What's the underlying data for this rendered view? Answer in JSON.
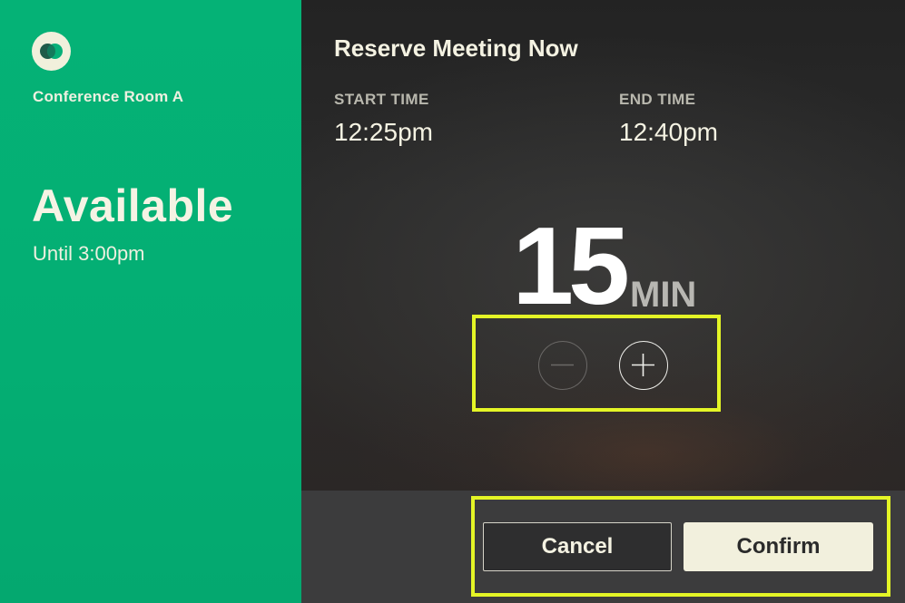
{
  "room": {
    "name": "Conference Room A",
    "status": "Available",
    "status_detail": "Until 3:00pm",
    "logo_icon": "overlapping-circles-logo"
  },
  "booking": {
    "title": "Reserve Meeting Now",
    "start_label": "START TIME",
    "start_value": "12:25pm",
    "end_label": "END TIME",
    "end_value": "12:40pm",
    "duration_value": "15",
    "duration_unit": "MIN",
    "decrease_icon": "minus-icon",
    "increase_icon": "plus-icon",
    "decrease_enabled": false,
    "increase_enabled": true
  },
  "actions": {
    "cancel_label": "Cancel",
    "confirm_label": "Confirm"
  },
  "colors": {
    "available_green": "#05b276",
    "highlight_yellow": "#e4f526",
    "cream": "#f2f0dd",
    "dark_panel": "#2a2a2a"
  }
}
